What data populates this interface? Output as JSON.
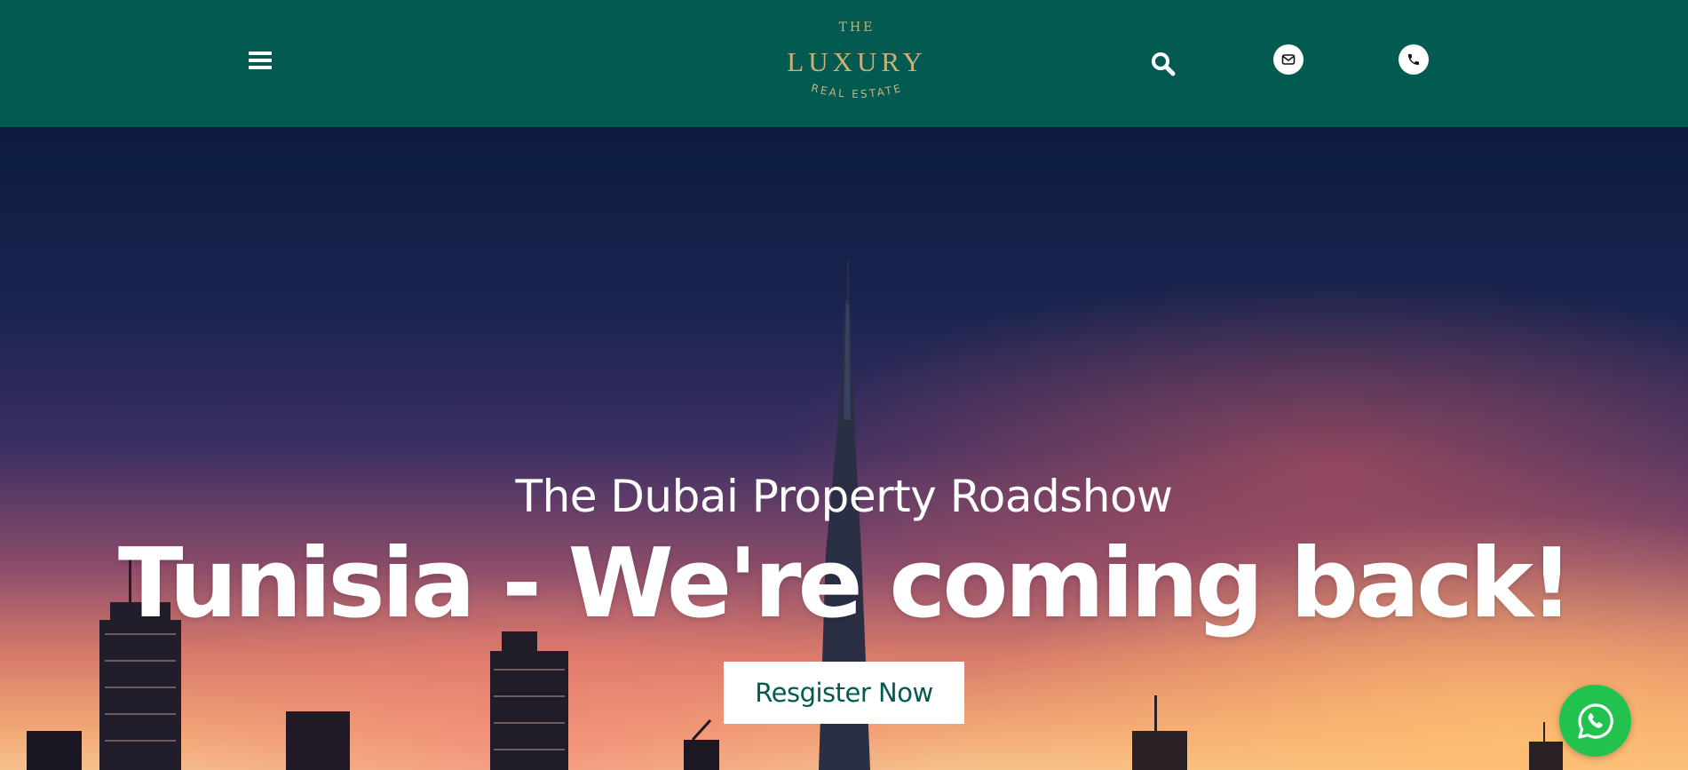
{
  "header": {
    "background_color": "#025a50",
    "menu_icon": "hamburger-icon",
    "logo": {
      "top_text": "THE",
      "main_text": "LUXURY",
      "bottom_text": "REAL ESTATE",
      "color": "#c9b27a"
    },
    "search_icon": "search-icon",
    "mail_icon": "mail-icon",
    "phone_icon": "phone-icon"
  },
  "hero": {
    "subtitle": "The Dubai Property Roadshow",
    "title": "Tunisia - We're coming back!",
    "cta_label": "Resgister Now",
    "cta_text_color": "#025a50"
  },
  "floating": {
    "whatsapp_icon": "whatsapp-icon",
    "whatsapp_color": "#22c24f"
  }
}
